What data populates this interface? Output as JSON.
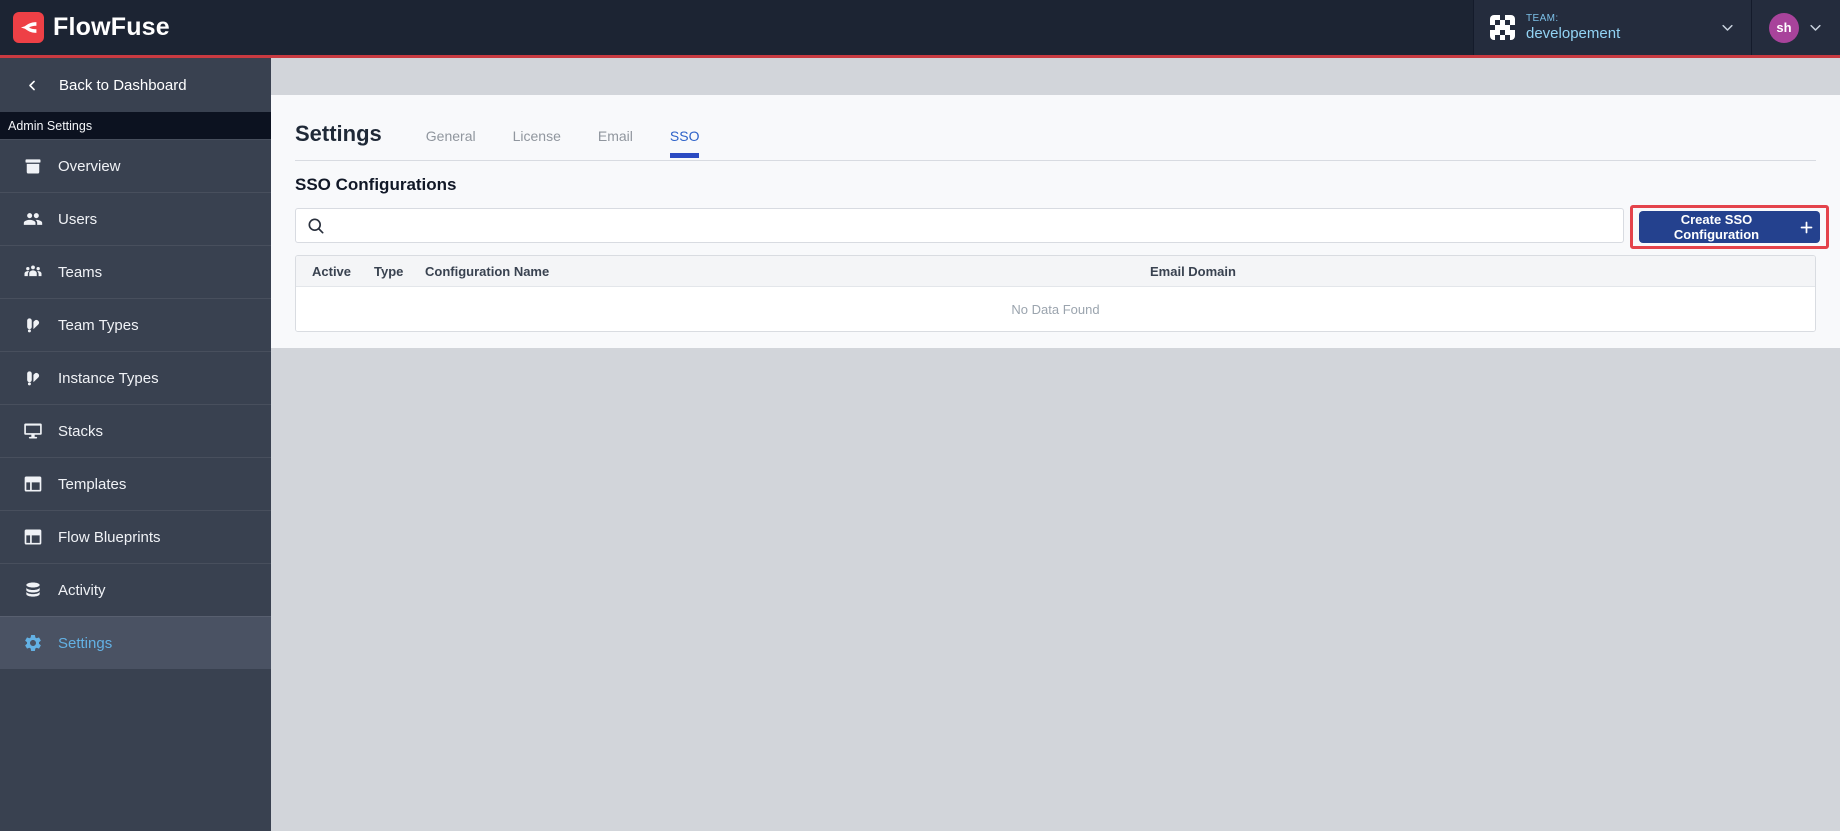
{
  "brand": {
    "name": "FlowFuse"
  },
  "topbar": {
    "team": {
      "label": "TEAM:",
      "name": "developement"
    },
    "user": {
      "initials": "sh"
    }
  },
  "sidebar": {
    "back_label": "Back to Dashboard",
    "section_label": "Admin Settings",
    "items": [
      {
        "label": "Overview",
        "icon": "overview-icon",
        "active": false
      },
      {
        "label": "Users",
        "icon": "users-icon",
        "active": false
      },
      {
        "label": "Teams",
        "icon": "teams-icon",
        "active": false
      },
      {
        "label": "Team Types",
        "icon": "team-types-icon",
        "active": false
      },
      {
        "label": "Instance Types",
        "icon": "instance-types-icon",
        "active": false
      },
      {
        "label": "Stacks",
        "icon": "stacks-icon",
        "active": false
      },
      {
        "label": "Templates",
        "icon": "templates-icon",
        "active": false
      },
      {
        "label": "Flow Blueprints",
        "icon": "flow-blueprints-icon",
        "active": false
      },
      {
        "label": "Activity",
        "icon": "activity-icon",
        "active": false
      },
      {
        "label": "Settings",
        "icon": "settings-icon",
        "active": true
      }
    ]
  },
  "main": {
    "title": "Settings",
    "tabs": [
      {
        "label": "General",
        "active": false
      },
      {
        "label": "License",
        "active": false
      },
      {
        "label": "Email",
        "active": false
      },
      {
        "label": "SSO",
        "active": true
      }
    ],
    "section_title": "SSO Configurations",
    "search": {
      "placeholder": "",
      "value": ""
    },
    "create_button": {
      "label": "Create SSO Configuration"
    },
    "table": {
      "columns": [
        "Active",
        "Type",
        "Configuration Name",
        "Email Domain"
      ],
      "rows": [],
      "empty_text": "No Data Found"
    }
  },
  "colors": {
    "topbar_bg": "#1c2433",
    "topbar_accent_red": "#c93a41",
    "annotation_red": "#e4434b",
    "sidebar_bg": "#394150",
    "sidebar_active_bg": "#4a5263",
    "sidebar_active_text": "#63b1e4",
    "tab_active_text": "#2f63c9",
    "tab_underline": "#2b4bc2",
    "create_button_bg": "#24418e",
    "team_text": "#92d3f4",
    "avatar_bg": "#a8439b",
    "page_bg": "#d2d5da",
    "panel_bg": "#f8f9fb"
  }
}
